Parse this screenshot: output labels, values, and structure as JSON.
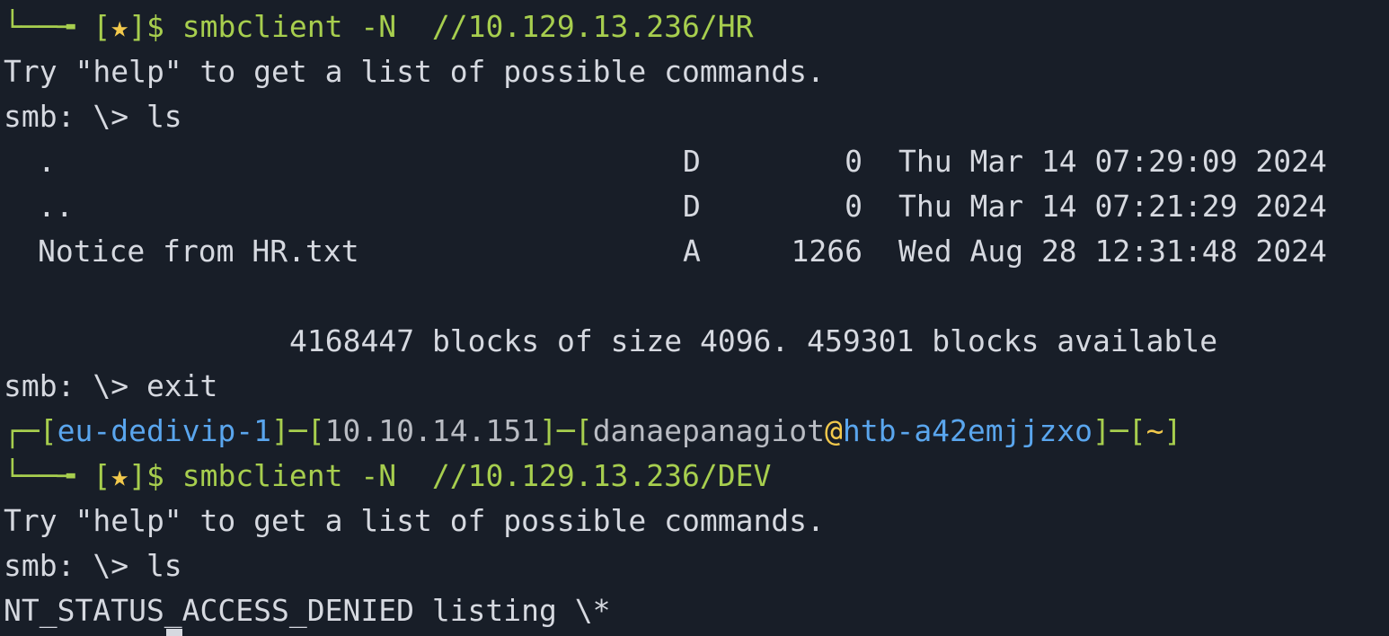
{
  "terminal": {
    "colors": {
      "background": "#181e28",
      "text": "#d6d9e0",
      "prompt_green": "#a7ce4e",
      "star_yellow": "#f2c94c",
      "host_blue": "#5aa6ee"
    },
    "session1": {
      "prompt_prefix": "└──╼ ",
      "prompt_open": "[",
      "prompt_star": "★",
      "prompt_close": "]$ ",
      "command": "smbclient -N  //10.129.13.236/HR",
      "help_msg": "Try \"help\" to get a list of possible commands.",
      "smb_prompt_ls": "smb: \\> ls",
      "listing": [
        {
          "name": ".",
          "attr": "D",
          "size": "0",
          "date": "Thu Mar 14 07:29:09 2024"
        },
        {
          "name": "..",
          "attr": "D",
          "size": "0",
          "date": "Thu Mar 14 07:21:29 2024"
        },
        {
          "name": "Notice from HR.txt",
          "attr": "A",
          "size": "1266",
          "date": "Wed Aug 28 12:31:48 2024"
        }
      ],
      "blocks_info": "4168447 blocks of size 4096. 459301 blocks available",
      "smb_prompt_exit": "smb: \\> exit"
    },
    "prompt_header": {
      "corner": "┌─",
      "lb1": "[",
      "vpn": "eu-dedivip-1",
      "sep1": "]─[",
      "ip": "10.10.14.151",
      "sep2": "]─[",
      "user": "danaepanagiot",
      "at": "@",
      "host": "htb-a42emjjzxo",
      "sep3": "]─[",
      "cwd": "~",
      "rb": "]"
    },
    "session2": {
      "prompt_prefix": "└──╼ ",
      "prompt_open": "[",
      "prompt_star": "★",
      "prompt_close": "]$ ",
      "command": "smbclient -N  //10.129.13.236/DEV",
      "help_msg": "Try \"help\" to get a list of possible commands.",
      "smb_prompt_ls": "smb: \\> ls",
      "error": "NT_STATUS_ACCESS_DENIED listing \\*"
    }
  }
}
